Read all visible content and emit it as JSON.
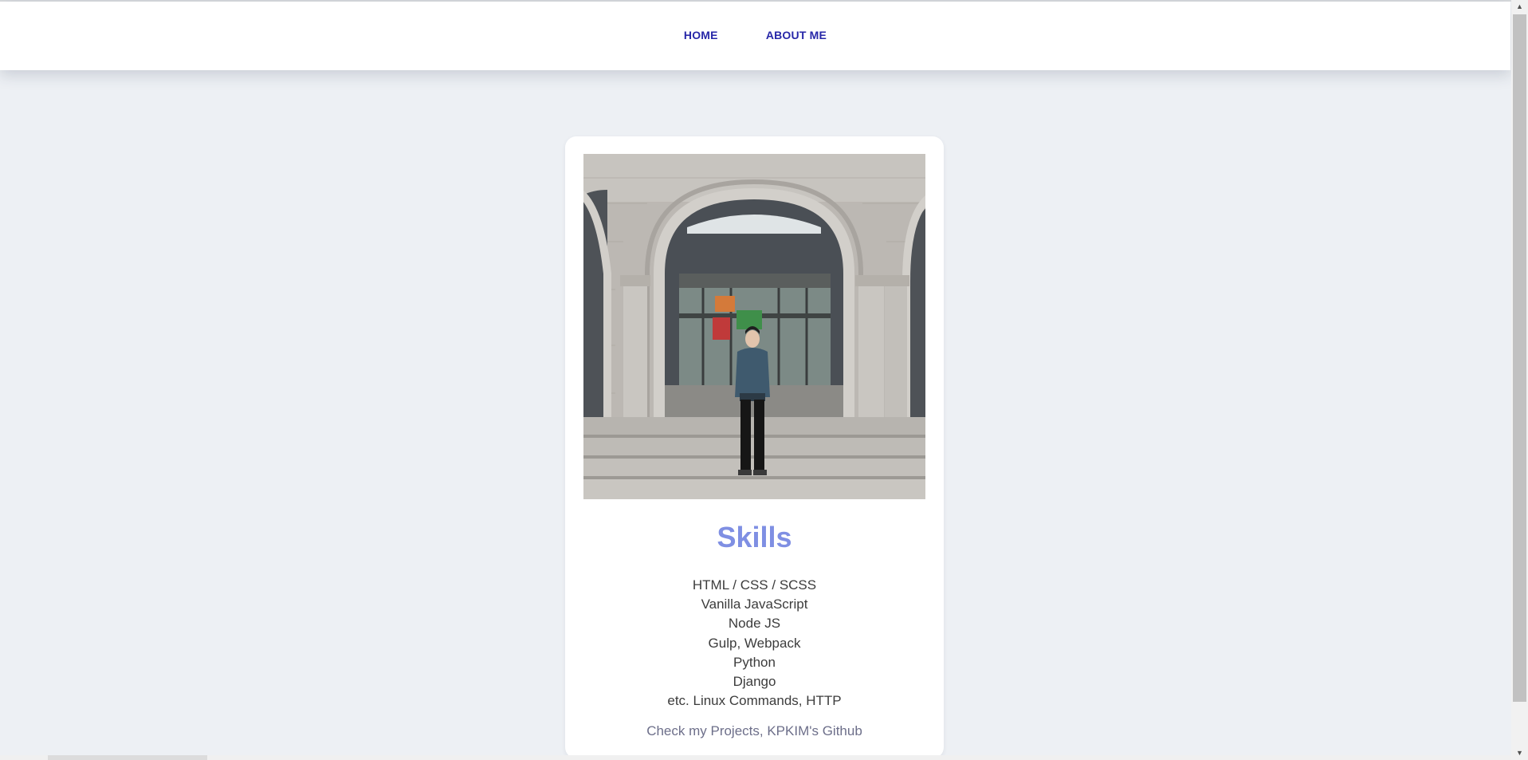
{
  "nav": {
    "home_label": "HOME",
    "about_label": "ABOUT ME",
    "link_color": "#2727a8"
  },
  "profile": {
    "photo_icon": "profile-photo-image"
  },
  "skills": {
    "title": "Skills",
    "title_color": "#7f8fe3",
    "items": [
      "HTML / CSS / SCSS",
      "Vanilla JavaScript",
      "Node JS",
      "Gulp, Webpack",
      "Python",
      "Django",
      "etc. Linux Commands, HTTP"
    ],
    "github_link": "Check my Projects, KPKIM's Github"
  },
  "scrollbar": {
    "up_icon": "arrow-up-icon",
    "down_icon": "arrow-down-icon"
  },
  "colors": {
    "page_background": "#edf0f4",
    "card_background": "#ffffff"
  }
}
